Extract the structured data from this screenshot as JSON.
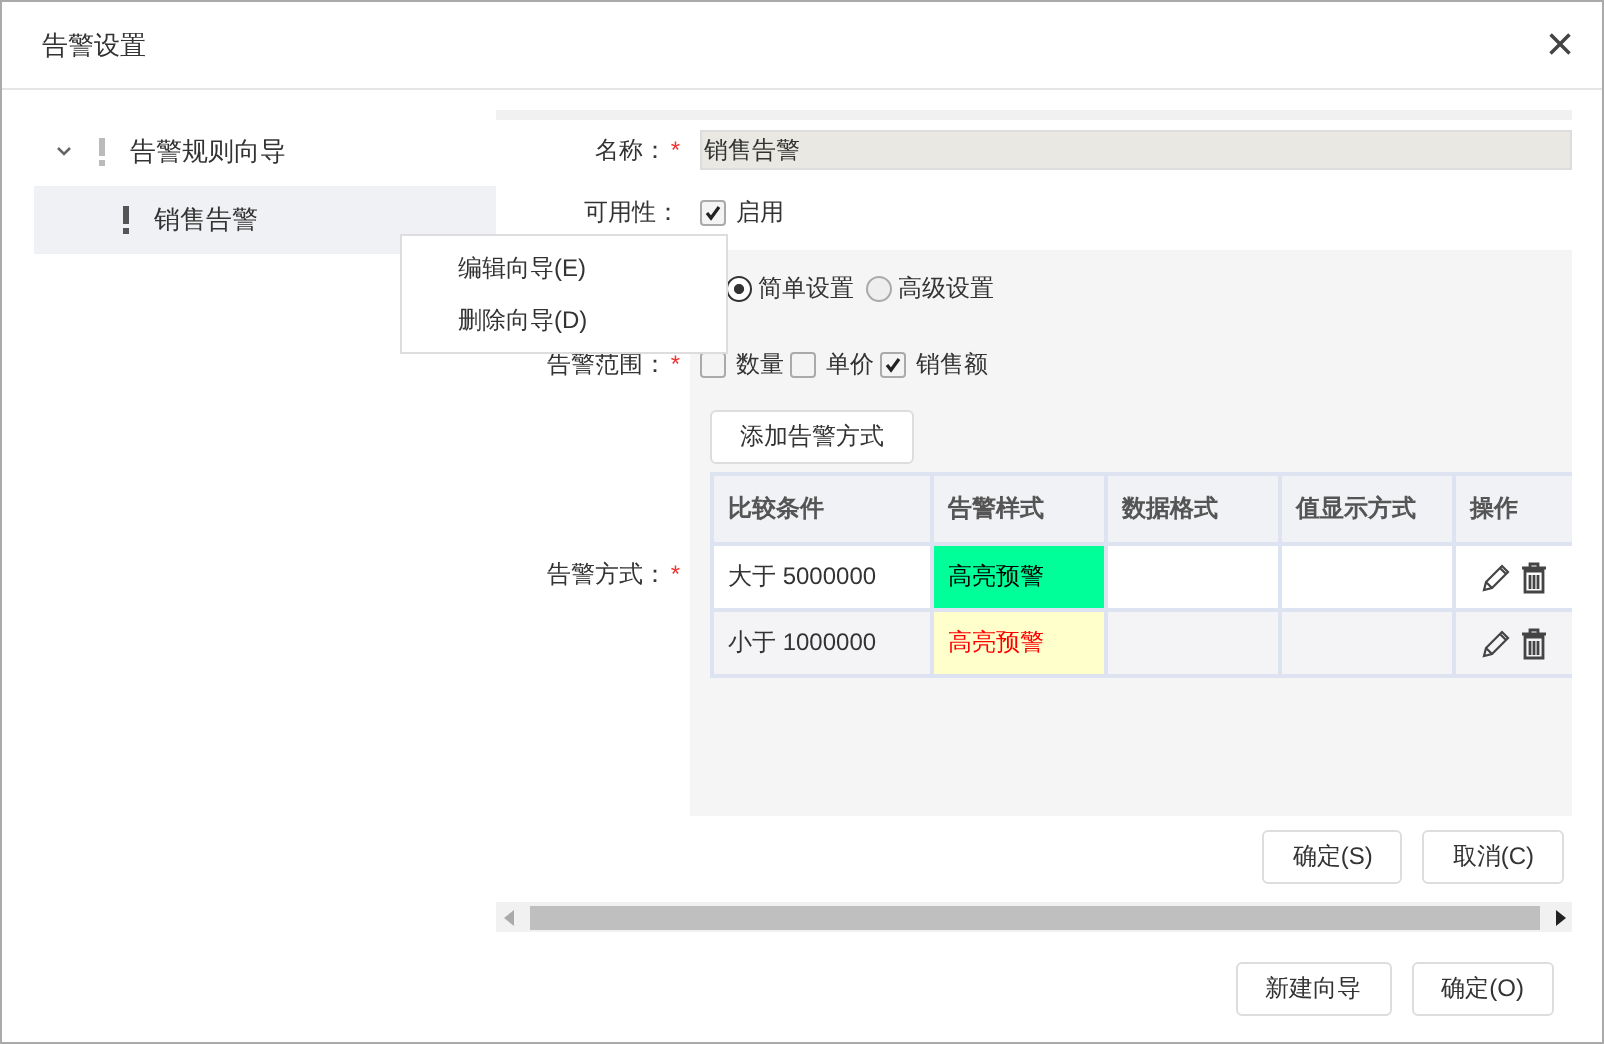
{
  "window": {
    "title": "告警设置",
    "close": "×"
  },
  "tree": [
    {
      "label": "告警规则向导",
      "expanded": true,
      "selected": false,
      "children": [
        {
          "label": "销售告警",
          "selected": true
        }
      ]
    }
  ],
  "context_menu": [
    "编辑向导(E)",
    "删除向导(D)"
  ],
  "form": {
    "name_label": "名称：",
    "name_mark": "*",
    "name_value": "销售告警",
    "availability_label": "可用性：",
    "enabled": {
      "label": "启用",
      "checked": true
    },
    "mode_options": [
      {
        "label": "简单设置",
        "selected": true
      },
      {
        "label": "高级设置",
        "selected": false
      }
    ],
    "range_label": "告警范围：",
    "range_mark": "*",
    "range_options": [
      {
        "label": "数量",
        "checked": false
      },
      {
        "label": "单价",
        "checked": false
      },
      {
        "label": "销售额",
        "checked": true
      }
    ],
    "add_button": "添加告警方式",
    "method_label": "告警方式：",
    "method_mark": "*"
  },
  "table": {
    "columns": [
      "比较条件",
      "告警样式",
      "数据格式",
      "值显示方式",
      "操作"
    ],
    "rows": [
      {
        "condition": "大于 5000000",
        "color": "#00ff99",
        "style": {
          "text": "高亮预警",
          "color": "#000000"
        }
      },
      {
        "condition": "小于 1000000",
        "color": "#ffffcc",
        "style": {
          "text": "高亮预警",
          "color": "#ff0000"
        }
      }
    ]
  },
  "panel_buttons": [
    "确定(S)",
    "取消(C)"
  ],
  "buttons": [
    "新建向导",
    "确定(O)"
  ]
}
